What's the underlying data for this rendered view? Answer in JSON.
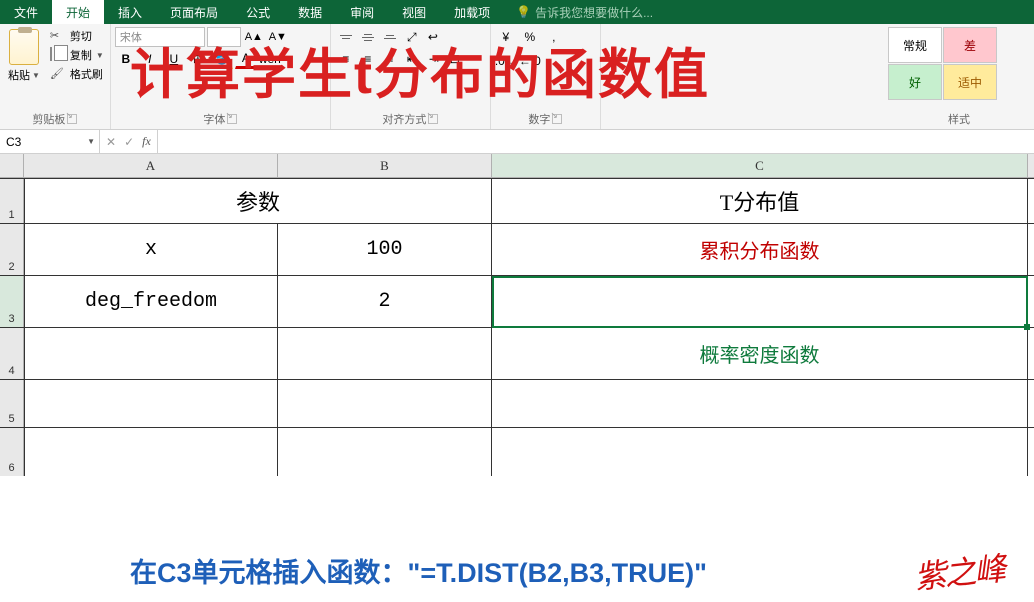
{
  "tabs": {
    "file": "文件",
    "home": "开始",
    "insert": "插入",
    "layout": "页面布局",
    "formulas": "公式",
    "data": "数据",
    "review": "审阅",
    "view": "视图",
    "addins": "加载项",
    "hint": "告诉我您想要做什么..."
  },
  "ribbon": {
    "paste": "粘贴",
    "cut": "剪切",
    "copy": "复制",
    "format_painter": "格式刷",
    "clipboard": "剪贴板",
    "font_name": "宋体",
    "font_size": "",
    "font": "字体",
    "alignment": "对齐方式",
    "number": "数字",
    "number_format": "常规",
    "styles": "样式",
    "style_normal": "常规",
    "style_good": "好",
    "style_bad": "差",
    "style_neutral": "适中"
  },
  "overlay_title": "计算学生t分布的函数值",
  "formula_bar": {
    "name_box": "C3",
    "formula": ""
  },
  "cols": {
    "A": "A",
    "B": "B",
    "C": "C"
  },
  "rows": {
    "r1": "1",
    "r2": "2",
    "r3": "3",
    "r4": "4",
    "r5": "5",
    "r6": "6"
  },
  "cells": {
    "params_header": "参数",
    "tdist_header": "T分布值",
    "x_label": "x",
    "x_value": "100",
    "cdf_label": "累积分布函数",
    "deg_label": "deg_freedom",
    "deg_value": "2",
    "pdf_label": "概率密度函数"
  },
  "caption": "在C3单元格插入函数：\"=T.DIST(B2,B3,TRUE)\"",
  "signature": "紫之峰"
}
